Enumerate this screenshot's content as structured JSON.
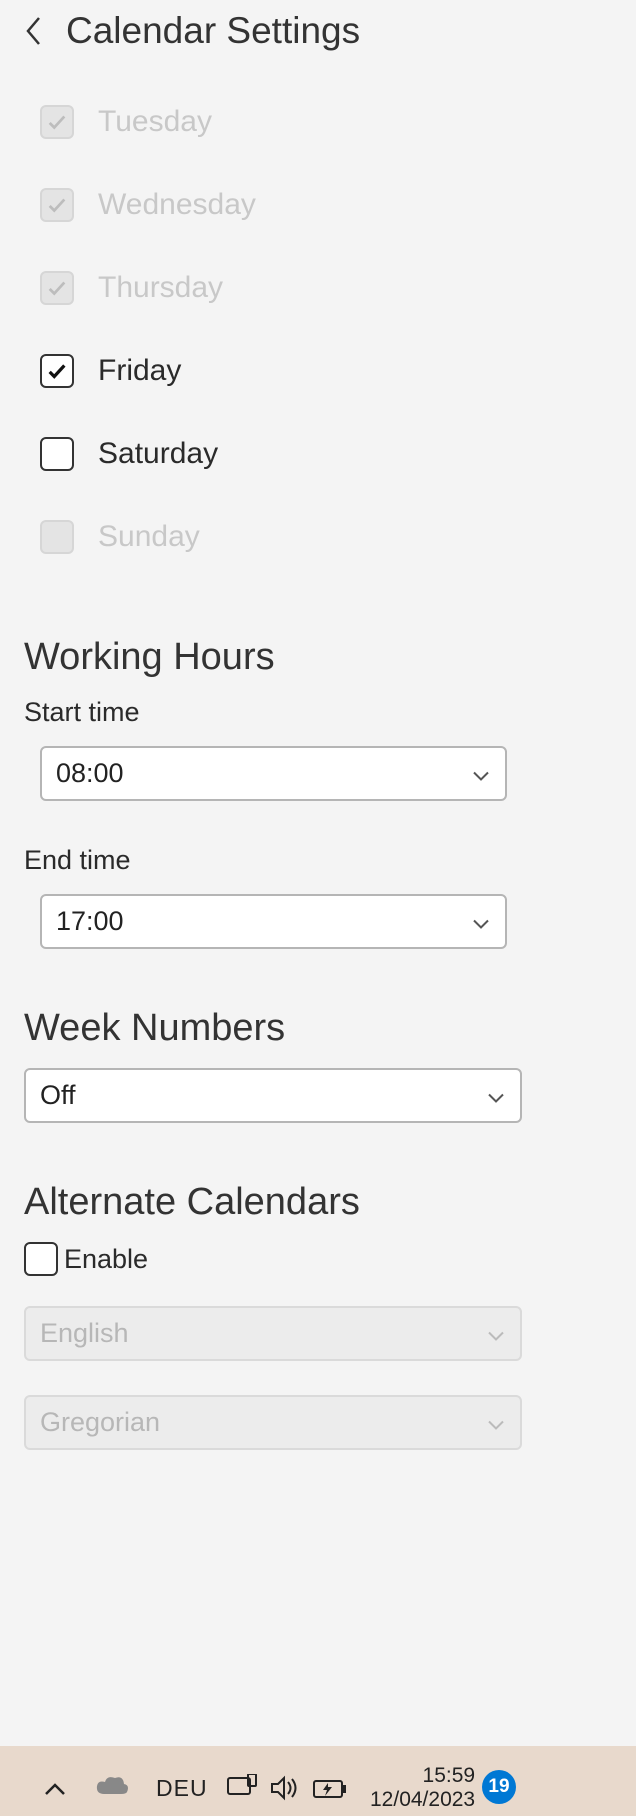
{
  "page_title": "Calendar Settings",
  "days": [
    {
      "label": "Tuesday",
      "checked": true,
      "enabled": false
    },
    {
      "label": "Wednesday",
      "checked": true,
      "enabled": false
    },
    {
      "label": "Thursday",
      "checked": true,
      "enabled": false
    },
    {
      "label": "Friday",
      "checked": true,
      "enabled": true
    },
    {
      "label": "Saturday",
      "checked": false,
      "enabled": true
    },
    {
      "label": "Sunday",
      "checked": false,
      "enabled": false
    }
  ],
  "working_hours": {
    "title": "Working Hours",
    "start_label": "Start time",
    "start_value": "08:00",
    "end_label": "End time",
    "end_value": "17:00"
  },
  "week_numbers": {
    "title": "Week Numbers",
    "value": "Off"
  },
  "alternate_calendars": {
    "title": "Alternate Calendars",
    "enable_label": "Enable",
    "enable_checked": false,
    "language_value": "English",
    "system_value": "Gregorian"
  },
  "taskbar": {
    "language": "DEU",
    "time": "15:59",
    "date": "12/04/2023",
    "notification_count": "19"
  }
}
